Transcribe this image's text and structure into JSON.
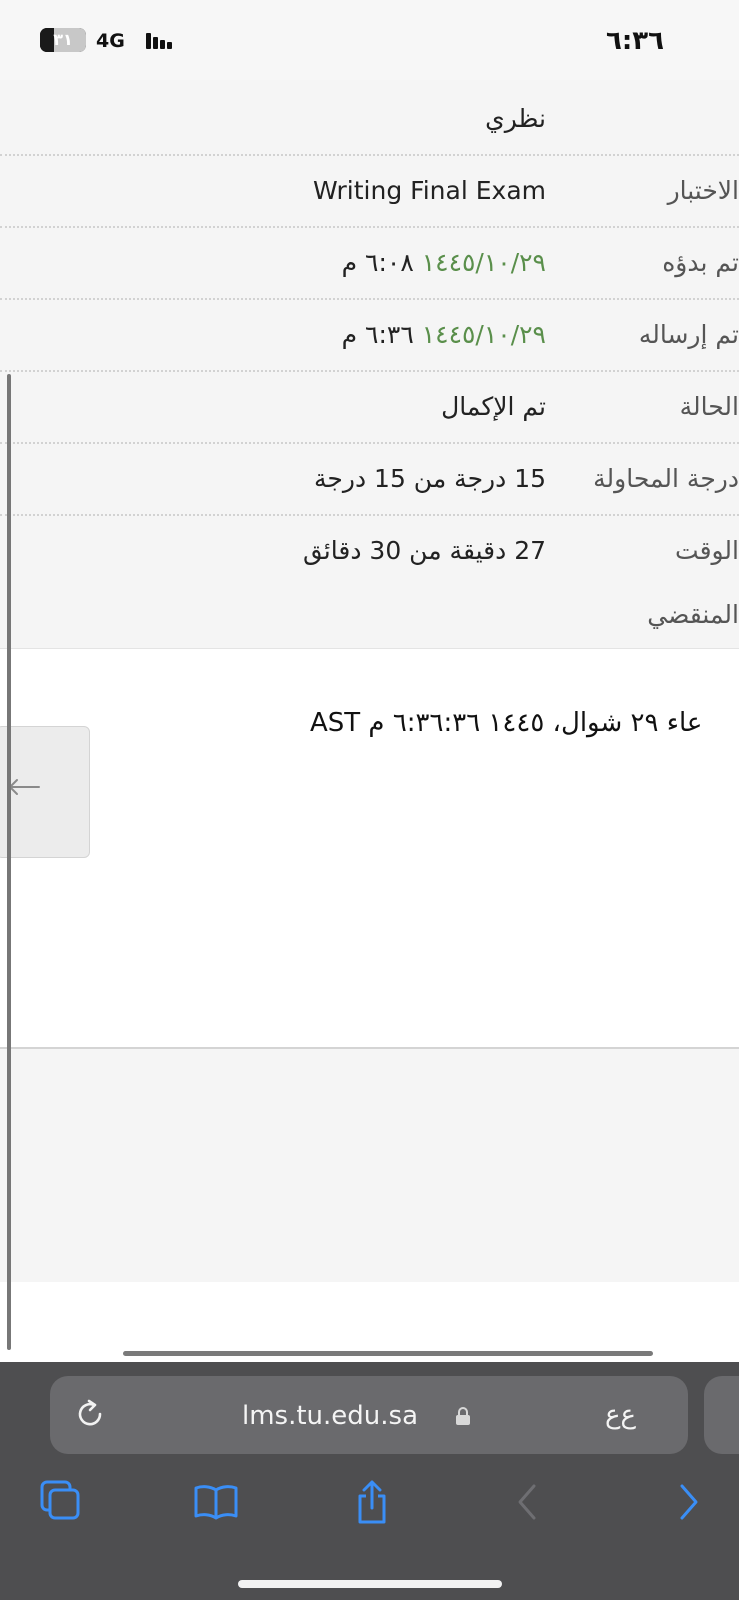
{
  "status_bar": {
    "time": "٦:٣٦",
    "network": "4G",
    "battery_label": "٣١",
    "battery_level_percent": 31
  },
  "attempt": {
    "rows": [
      {
        "label": "",
        "value": "نظري"
      },
      {
        "label": "الاختبار",
        "value": "Writing Final Exam"
      },
      {
        "label": "تم بدؤه",
        "value_date": "١٤٤٥/١٠/٢٩",
        "value_time": "٦:٠٨ م"
      },
      {
        "label": "تم إرساله",
        "value_date": "١٤٤٥/١٠/٢٩",
        "value_time": "٦:٣٦ م"
      },
      {
        "label": "الحالة",
        "value": "تم الإكمال"
      },
      {
        "label": "درجة المحاولة",
        "value": "15 درجة من 15 درجة"
      },
      {
        "label": "الوقت",
        "label_line2": "المنقضي",
        "value": "27 دقيقة من 30 دقائق"
      }
    ]
  },
  "footer": {
    "date_text": "عاء ٢٩ شوال، ١٤٤٥ ٦:٣٦:٣٦ م AST"
  },
  "browser": {
    "url": "lms.tu.edu.sa",
    "text_size_label": "ع‌ع"
  },
  "colors": {
    "date_green": "#5a8f4b",
    "link_blue": "#3a8ef6",
    "toolbar_bg": "#4e4e50"
  }
}
